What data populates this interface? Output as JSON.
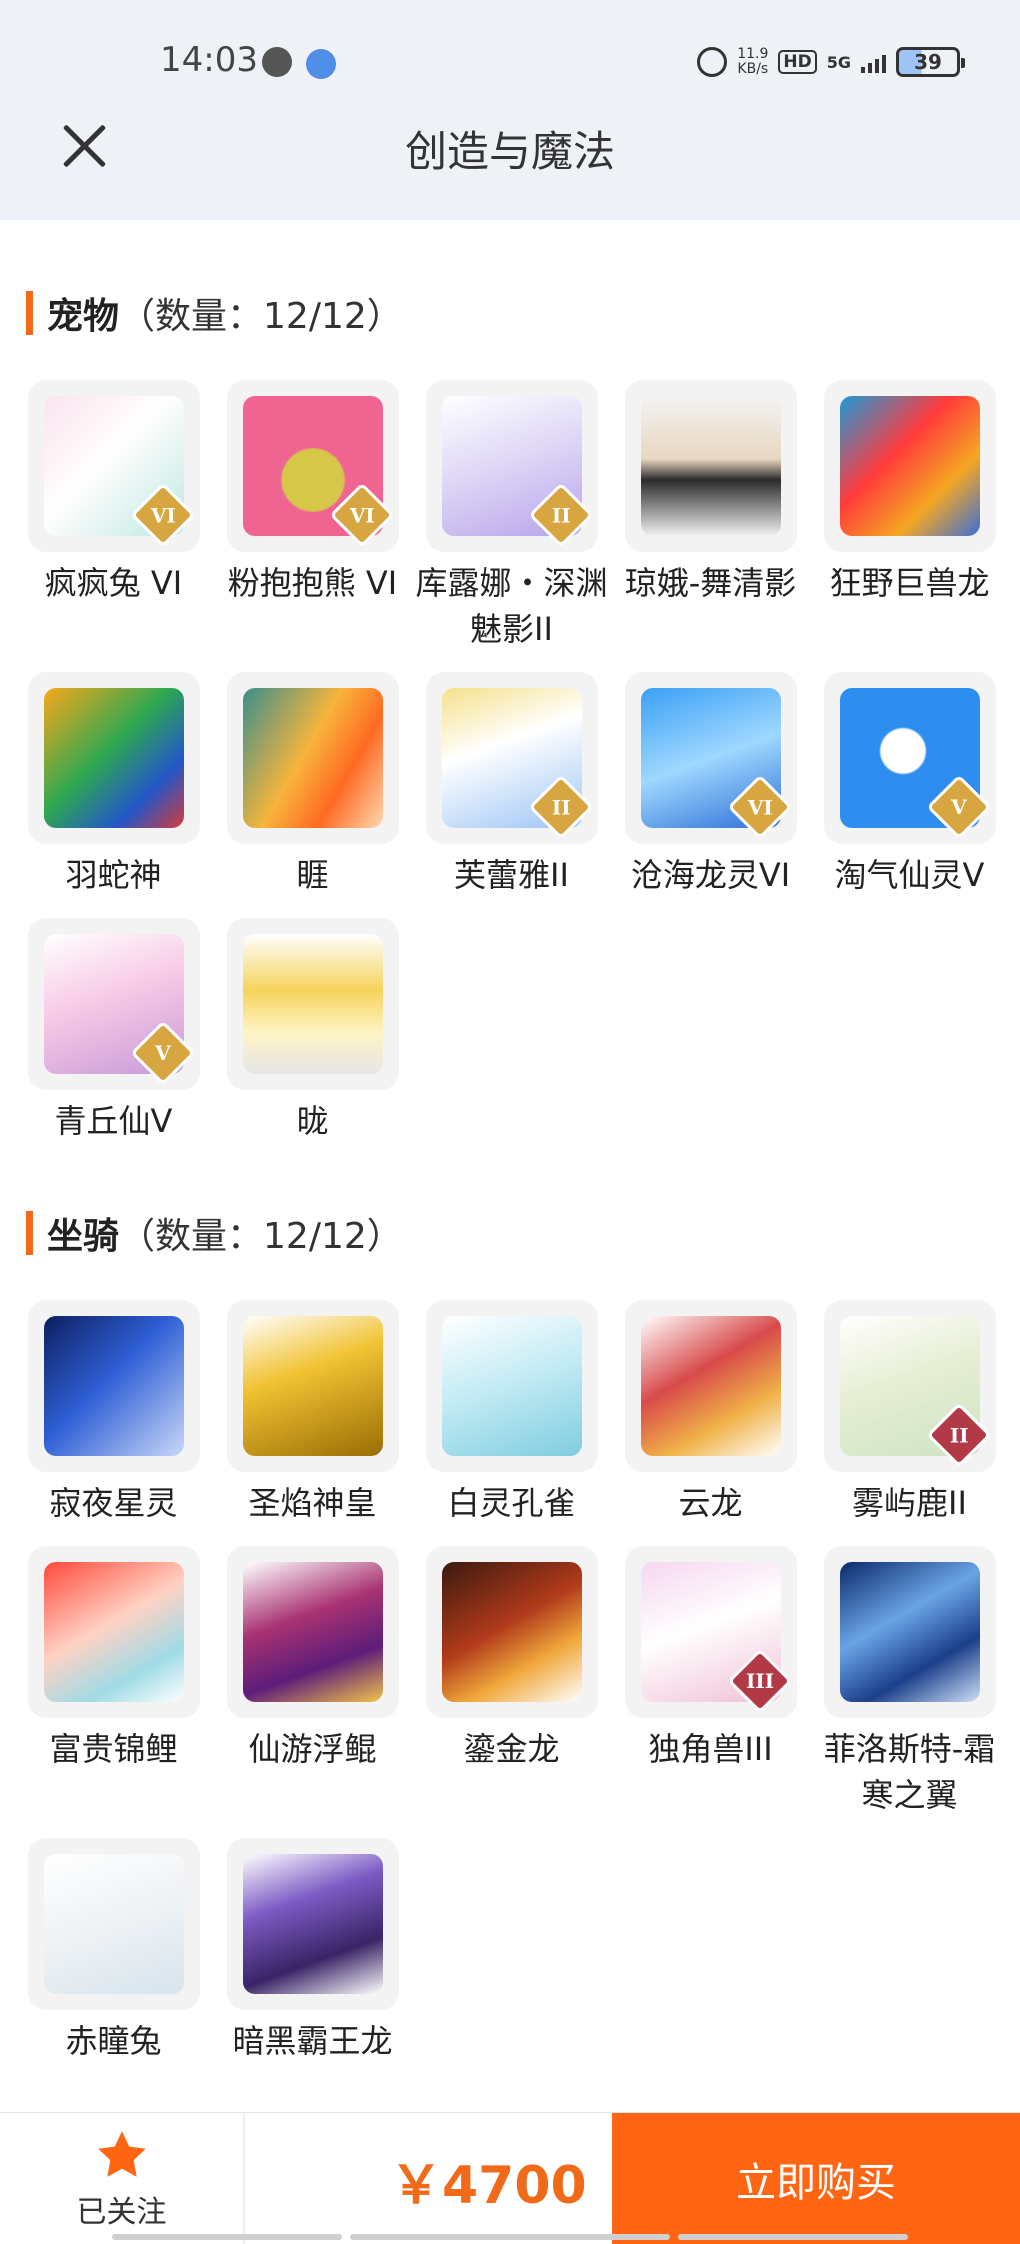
{
  "status_bar": {
    "time": "14:03",
    "net_speed_value": "11.9",
    "net_speed_unit": "KB/s",
    "hd": "HD",
    "signal": "5G",
    "battery": "39"
  },
  "header": {
    "title": "创造与魔法",
    "close_icon": "close-icon"
  },
  "pets": {
    "name": "宠物",
    "count": "（数量：12/12）",
    "items": [
      {
        "label": "疯疯兔 VI",
        "tier": "VI",
        "tier_color": "gold",
        "art": "linear-gradient(135deg,#fbe3ee,#ffffff 45%,#bde6df)"
      },
      {
        "label": "粉抱抱熊 VI",
        "tier": "VI",
        "tier_color": "gold",
        "art": "radial-gradient(circle at 50% 60%,#d6c64a 0 28%,#f06492 30% 100%)"
      },
      {
        "label": "库露娜・深渊魅影II",
        "tier": "II",
        "tier_color": "gold",
        "art": "linear-gradient(160deg,#ffffff,#dcd4f5 50%,#b9a3ea)"
      },
      {
        "label": "琼娥-舞清影",
        "tier": "",
        "tier_color": "",
        "art": "linear-gradient(180deg,#f3f3f3,#e8d6c0 45%,#2b2b2b 60%,#f1f1f1)"
      },
      {
        "label": "狂野巨兽龙",
        "tier": "",
        "tier_color": "",
        "art": "linear-gradient(135deg,#1e9ad6,#ff3b3b 40%,#f5a623 70%,#3b6fd6)"
      },
      {
        "label": "羽蛇神",
        "tier": "",
        "tier_color": "",
        "art": "linear-gradient(135deg,#f7a81b,#2fa84f 45%,#2356c9 75%,#d43b3b)"
      },
      {
        "label": "睚",
        "tier": "",
        "tier_color": "",
        "art": "linear-gradient(120deg,#3a8f8a,#f7b43c 45%,#ff6a22 70%,#ffd9b0)"
      },
      {
        "label": "芙蕾雅II",
        "tier": "II",
        "tier_color": "gold",
        "art": "linear-gradient(160deg,#f5e08a,#ffffff 40%,#9cc4f5)"
      },
      {
        "label": "沧海龙灵VI",
        "tier": "VI",
        "tier_color": "gold",
        "art": "linear-gradient(160deg,#3aa0f5,#9fd7ff 50%,#2c6fd6)"
      },
      {
        "label": "淘气仙灵V",
        "tier": "V",
        "tier_color": "gold",
        "art": "radial-gradient(circle at 45% 45%,#ffffff 0 20%,#2d8ef0 22% 100%)"
      },
      {
        "label": "青丘仙V",
        "tier": "V",
        "tier_color": "gold",
        "art": "linear-gradient(160deg,#ffffff,#f7c9e6 45%,#c79ad8)"
      },
      {
        "label": "昽",
        "tier": "",
        "tier_color": "",
        "art": "linear-gradient(180deg,#ffffff,#f5d35a 40%,#fff3c4 70%,#e6e6e6)"
      }
    ]
  },
  "mounts": {
    "name": "坐骑",
    "count": "（数量：12/12）",
    "items": [
      {
        "label": "寂夜星灵",
        "tier": "",
        "tier_color": "",
        "art": "linear-gradient(135deg,#0d1f5e,#2f5fd6 45%,#c9d6f7)"
      },
      {
        "label": "圣焰神皇",
        "tier": "",
        "tier_color": "",
        "art": "linear-gradient(160deg,#ffffff,#f1c232 40%,#9a6d05)"
      },
      {
        "label": "白灵孔雀",
        "tier": "",
        "tier_color": "",
        "art": "linear-gradient(160deg,#ffffff,#c6ecf5 45%,#7fcde0)"
      },
      {
        "label": "云龙",
        "tier": "",
        "tier_color": "",
        "art": "linear-gradient(150deg,#ffffff,#d84a4a 40%,#f0b248 70%,#ffffff)"
      },
      {
        "label": "雾屿鹿II",
        "tier": "II",
        "tier_color": "red",
        "art": "linear-gradient(160deg,#ffffff,#e7eed4 45%,#cde3c4)"
      },
      {
        "label": "富贵锦鲤",
        "tier": "",
        "tier_color": "",
        "art": "linear-gradient(150deg,#ff4a3b,#ffd2c4 45%,#9fdbe6 75%,#ffffff)"
      },
      {
        "label": "仙游浮鲲",
        "tier": "",
        "tier_color": "",
        "art": "linear-gradient(160deg,#ffffff,#a83272 40%,#5d1d7a 70%,#f3c34a)"
      },
      {
        "label": "鎏金龙",
        "tier": "",
        "tier_color": "",
        "art": "linear-gradient(150deg,#3a1a10,#b13a1a 45%,#f0a83c 70%,#ffffff)"
      },
      {
        "label": "独角兽III",
        "tier": "III",
        "tier_color": "red",
        "art": "linear-gradient(160deg,#f6d6f0,#ffffff 45%,#f0c0d6)"
      },
      {
        "label": "菲洛斯特-霜寒之翼",
        "tier": "",
        "tier_color": "",
        "art": "linear-gradient(150deg,#0b2a6b,#6aa4e6 40%,#1b3f8a 70%,#cfe0f7)"
      },
      {
        "label": "赤瞳兔",
        "tier": "",
        "tier_color": "",
        "art": "linear-gradient(160deg,#ffffff,#eef2f5 50%,#d7e4ec)"
      },
      {
        "label": "暗黑霸王龙",
        "tier": "",
        "tier_color": "",
        "art": "linear-gradient(160deg,#ffffff,#7c5bc4 35%,#3a2466 70%,#ffffff)"
      }
    ]
  },
  "footer": {
    "follow_label": "已关注",
    "star_color": "#ff6512",
    "price": "￥4700",
    "buy_label": "立即购买",
    "accent": "#ff6512"
  }
}
